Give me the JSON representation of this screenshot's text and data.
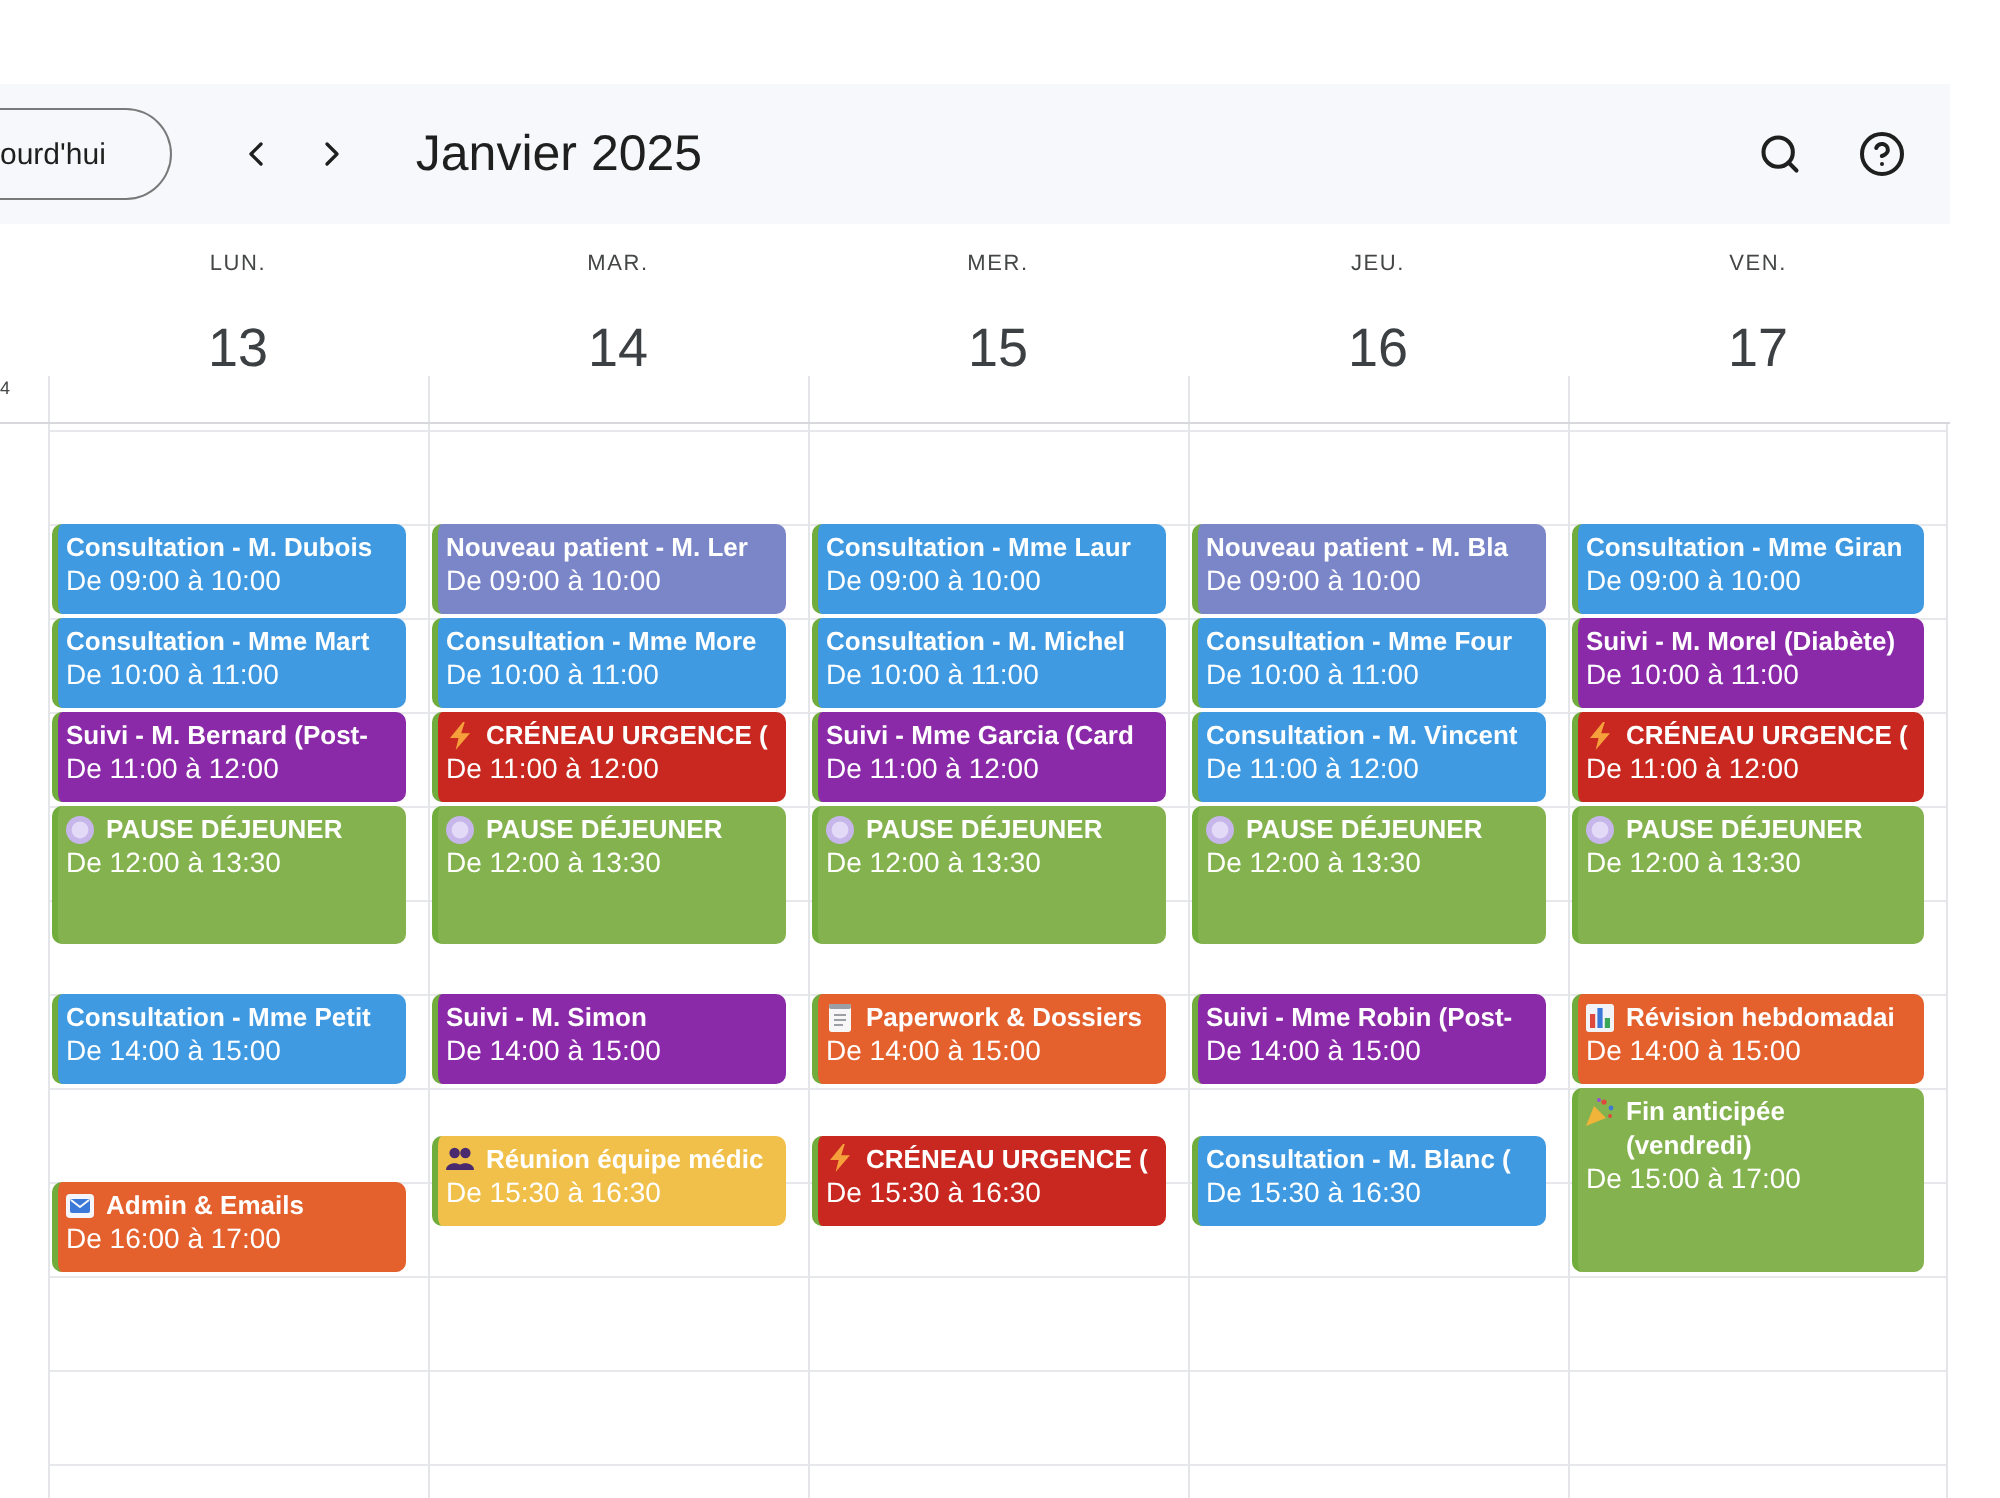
{
  "toolbar": {
    "today_button": "ourd'hui",
    "title": "Janvier 2025"
  },
  "timezone_label": "4",
  "days": [
    {
      "weekday": "LUN.",
      "date": "13",
      "events": [
        {
          "kind": "appointment",
          "color": "#3f9ae2",
          "title": "Consultation - M. Dubois",
          "time": "De 09:00 à 10:00"
        },
        {
          "kind": "appointment",
          "color": "#3f9ae2",
          "title": "Consultation - Mme Mart",
          "time": "De 10:00 à 11:00"
        },
        {
          "kind": "appointment",
          "color": "#8b2aa8",
          "title": "Suivi - M. Bernard (Post-",
          "time": "De 11:00 à 12:00"
        },
        {
          "kind": "lunch",
          "color": "#84b24e",
          "title": "PAUSE DÉJEUNER",
          "time": "De 12:00 à 13:30"
        },
        {
          "kind": "appointment",
          "color": "#3f9ae2",
          "title": "Consultation - Mme Petit",
          "time": "De 14:00 à 15:00"
        },
        {
          "kind": "admin",
          "color": "#e4602d",
          "title": "Admin & Emails",
          "time": "De 16:00 à 17:00"
        }
      ]
    },
    {
      "weekday": "MAR.",
      "date": "14",
      "events": [
        {
          "kind": "appointment",
          "color": "#7b86c9",
          "title": "Nouveau patient - M. Ler",
          "time": "De 09:00 à 10:00"
        },
        {
          "kind": "appointment",
          "color": "#3f9ae2",
          "title": "Consultation - Mme More",
          "time": "De 10:00 à 11:00"
        },
        {
          "kind": "urgent",
          "color": "#c8281f",
          "title": "CRÉNEAU URGENCE (",
          "time": "De 11:00 à 12:00"
        },
        {
          "kind": "lunch",
          "color": "#84b24e",
          "title": "PAUSE DÉJEUNER",
          "time": "De 12:00 à 13:30"
        },
        {
          "kind": "appointment",
          "color": "#8b2aa8",
          "title": "Suivi - M. Simon",
          "time": "De 14:00 à 15:00"
        },
        {
          "kind": "meeting",
          "color": "#f1c04a",
          "title": "Réunion équipe médic",
          "time": "De 15:30 à 16:30"
        }
      ]
    },
    {
      "weekday": "MER.",
      "date": "15",
      "events": [
        {
          "kind": "appointment",
          "color": "#3f9ae2",
          "title": "Consultation - Mme Laur",
          "time": "De 09:00 à 10:00"
        },
        {
          "kind": "appointment",
          "color": "#3f9ae2",
          "title": "Consultation - M. Michel",
          "time": "De 10:00 à 11:00"
        },
        {
          "kind": "appointment",
          "color": "#8b2aa8",
          "title": "Suivi - Mme Garcia (Card",
          "time": "De 11:00 à 12:00"
        },
        {
          "kind": "lunch",
          "color": "#84b24e",
          "title": "PAUSE DÉJEUNER",
          "time": "De 12:00 à 13:30"
        },
        {
          "kind": "paperwork",
          "color": "#e4602d",
          "title": "Paperwork & Dossiers",
          "time": "De 14:00 à 15:00"
        },
        {
          "kind": "urgent",
          "color": "#c8281f",
          "title": "CRÉNEAU URGENCE (",
          "time": "De 15:30 à 16:30"
        }
      ]
    },
    {
      "weekday": "JEU.",
      "date": "16",
      "events": [
        {
          "kind": "appointment",
          "color": "#7b86c9",
          "title": "Nouveau patient - M. Bla",
          "time": "De 09:00 à 10:00"
        },
        {
          "kind": "appointment",
          "color": "#3f9ae2",
          "title": "Consultation - Mme Four",
          "time": "De 10:00 à 11:00"
        },
        {
          "kind": "appointment",
          "color": "#3f9ae2",
          "title": "Consultation - M. Vincent",
          "time": "De 11:00 à 12:00"
        },
        {
          "kind": "lunch",
          "color": "#84b24e",
          "title": "PAUSE DÉJEUNER",
          "time": "De 12:00 à 13:30"
        },
        {
          "kind": "appointment",
          "color": "#8b2aa8",
          "title": "Suivi - Mme Robin (Post-",
          "time": "De 14:00 à 15:00"
        },
        {
          "kind": "appointment",
          "color": "#3f9ae2",
          "title": "Consultation - M. Blanc (",
          "time": "De 15:30 à 16:30"
        }
      ]
    },
    {
      "weekday": "VEN.",
      "date": "17",
      "events": [
        {
          "kind": "appointment",
          "color": "#3f9ae2",
          "title": "Consultation - Mme Giran",
          "time": "De 09:00 à 10:00"
        },
        {
          "kind": "appointment",
          "color": "#8b2aa8",
          "title": "Suivi - M. Morel (Diabète)",
          "time": "De 10:00 à 11:00"
        },
        {
          "kind": "urgent",
          "color": "#c8281f",
          "title": "CRÉNEAU URGENCE (",
          "time": "De 11:00 à 12:00"
        },
        {
          "kind": "lunch",
          "color": "#84b24e",
          "title": "PAUSE DÉJEUNER",
          "time": "De 12:00 à 13:30"
        },
        {
          "kind": "review",
          "color": "#e4602d",
          "title": "Révision hebdomadai",
          "time": "De 14:00 à 15:00"
        },
        {
          "kind": "celebration",
          "color": "#84b24e",
          "title": "Fin anticipée (vendredi)",
          "time": "De 15:00 à 17:00"
        }
      ]
    }
  ]
}
